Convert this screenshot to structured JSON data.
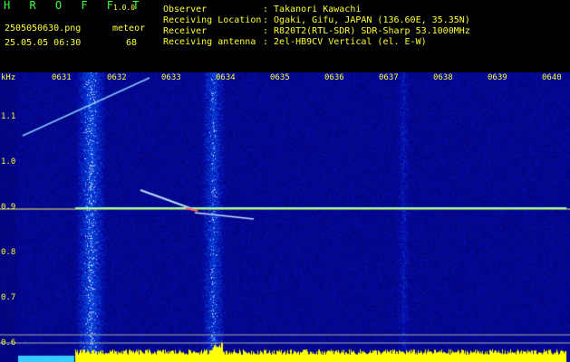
{
  "app": {
    "name": "H R O F F T",
    "version": "1.0.0"
  },
  "file": {
    "name": "2505050630.png",
    "datetime": "25.05.05 06:30"
  },
  "detection": {
    "label": "meteor",
    "count": "68"
  },
  "station": [
    {
      "label": "Observer",
      "value": ": Takanori Kawachi"
    },
    {
      "label": "Receiving Location",
      "value": ": Ogaki, Gifu, JAPAN (136.60E, 35.35N)"
    },
    {
      "label": "Receiver",
      "value": ": R820T2(RTL-SDR) SDR-Sharp 53.1000MHz"
    },
    {
      "label": "Receiving antenna",
      "value": ": 2el-HB9CV Vertical (el. E-W)"
    }
  ],
  "spectrogram": {
    "unit": "kHz",
    "time_ticks": [
      "0631",
      "0632",
      "0633",
      "0634",
      "0635",
      "0636",
      "0637",
      "0638",
      "0639",
      "0640"
    ],
    "freq_ticks": [
      "1.1",
      "1.0",
      "0.9",
      "0.8",
      "0.7",
      "0.6"
    ],
    "carrier_khz": 0.9,
    "colors": {
      "header_text": "#3dff3d",
      "label_text": "#ffff33",
      "carrier": "#7dffb0",
      "level": "#ffff00",
      "background": "#0a0a55"
    }
  }
}
